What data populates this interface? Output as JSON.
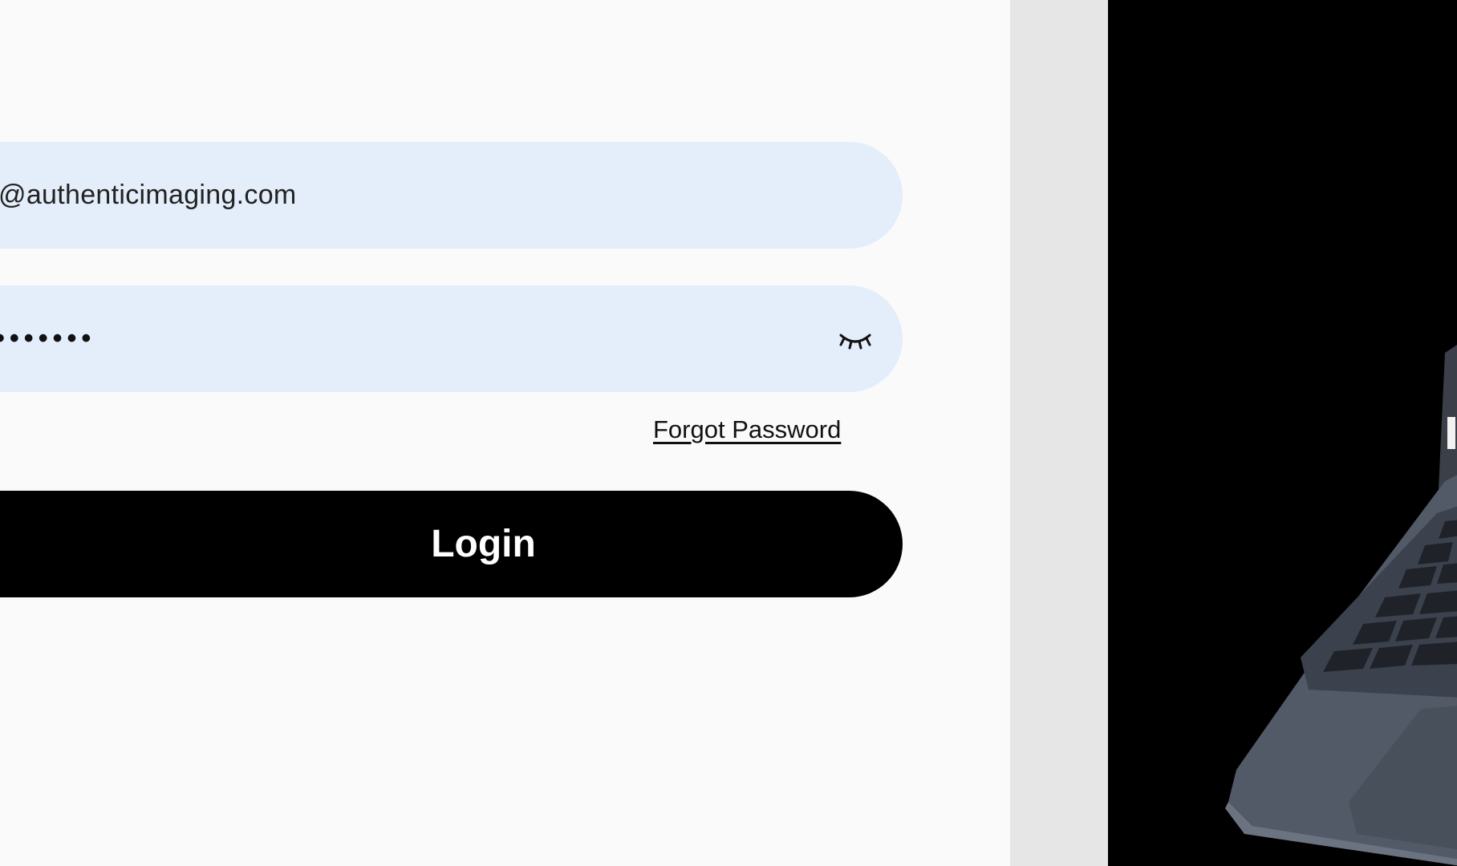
{
  "login_form": {
    "email_value": "@authenticimaging.com",
    "password_mask": "•••••••",
    "password_visibility_icon": "eye-closed-icon",
    "forgot_password_label": "Forgot Password",
    "login_button_label": "Login"
  },
  "hero_image": {
    "subject": "laptop-image"
  },
  "colors": {
    "panel_background": "#fafafa",
    "field_background": "#e4edfa",
    "button_background": "#000000",
    "button_text": "#ffffff",
    "gutter": "#e6e6e6",
    "hero_background": "#000000",
    "laptop_body": "#525a68"
  }
}
